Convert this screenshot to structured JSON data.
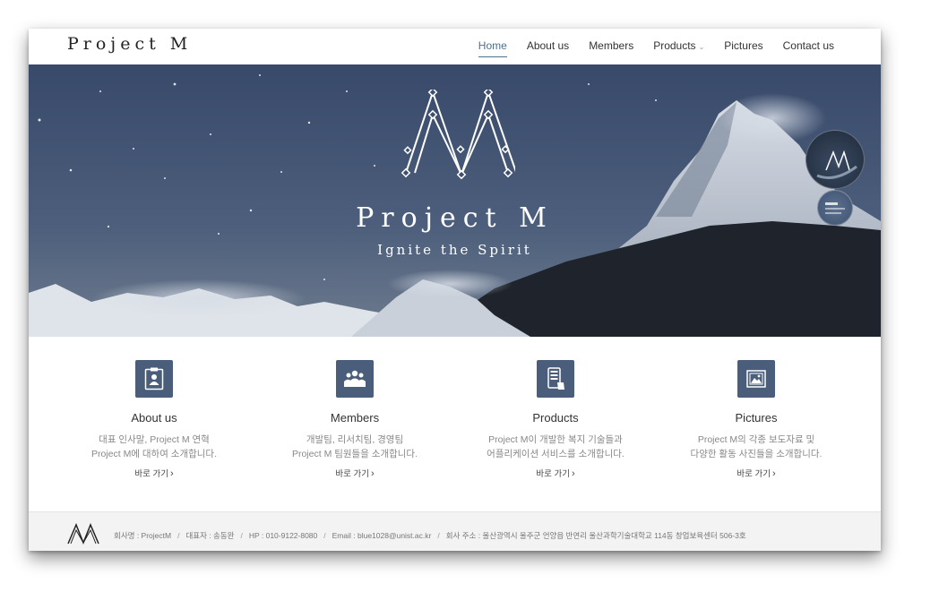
{
  "brand": "Project M",
  "nav": [
    {
      "label": "Home",
      "active": true
    },
    {
      "label": "About us",
      "active": false
    },
    {
      "label": "Members",
      "active": false
    },
    {
      "label": "Products",
      "active": false,
      "dropdown": true
    },
    {
      "label": "Pictures",
      "active": false
    },
    {
      "label": "Contact us",
      "active": false
    }
  ],
  "hero": {
    "title": "Project M",
    "subtitle": "Ignite the Spirit"
  },
  "features": [
    {
      "icon": "clipboard-user-icon",
      "title": "About us",
      "desc": "대표 인사말, Project M 연혁\nProject M에 대하여 소개합니다.",
      "link": "바로 가기"
    },
    {
      "icon": "team-icon",
      "title": "Members",
      "desc": "개발팀, 리서치팀, 경영팀\nProject M 팀원들을 소개합니다.",
      "link": "바로 가기"
    },
    {
      "icon": "mobile-device-icon",
      "title": "Products",
      "desc": "Project M이 개발한 복지 기술들과\n어플리케이션 서비스를 소개합니다.",
      "link": "바로 가기"
    },
    {
      "icon": "picture-icon",
      "title": "Pictures",
      "desc": "Project M의 각종 보도자료 및\n다양한 활동 사진들을 소개합니다.",
      "link": "바로 가기"
    }
  ],
  "footer": {
    "company": "회사명 : ProjectM",
    "ceo": "대표자 : 송동완",
    "phone": "HP : 010-9122-8080",
    "email": "Email : blue1028@unist.ac.kr",
    "address": "회사 주소 : 울산광역시 울주군 언양읍 반연리 울산과학기술대학교 114동 창업보육센터 506-3호"
  },
  "colors": {
    "accent": "#4f6f8f",
    "icon_bg": "#4a5d7a"
  }
}
